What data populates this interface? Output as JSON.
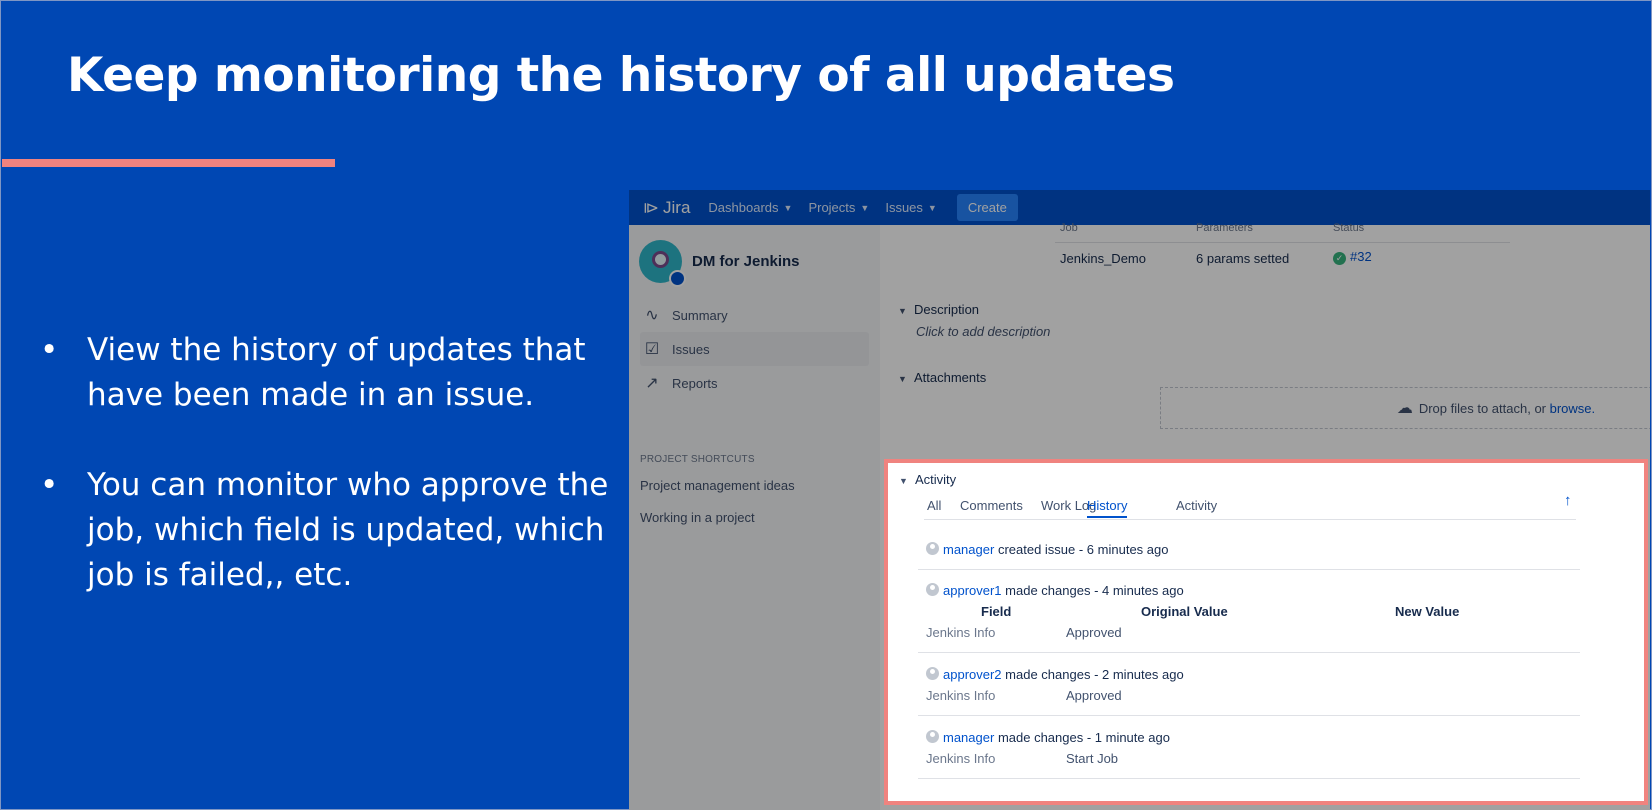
{
  "slide": {
    "title": "Keep monitoring the history of all updates",
    "bullets": [
      "View the history of updates that have been made in an issue.",
      "You can monitor who approve the job, which field is updated, which job is failed,, etc."
    ],
    "bullet_char": "•",
    "colors": {
      "background": "#0047b3",
      "accent": "#f0837f"
    }
  },
  "jira": {
    "logo": "Jira",
    "nav": [
      {
        "label": "Dashboards"
      },
      {
        "label": "Projects"
      },
      {
        "label": "Issues"
      }
    ],
    "create_label": "Create",
    "project_name": "DM for Jenkins",
    "sidebar": {
      "items": [
        {
          "label": "Summary",
          "icon": "pulse-icon"
        },
        {
          "label": "Issues",
          "icon": "issues-icon"
        },
        {
          "label": "Reports",
          "icon": "chart-icon"
        }
      ],
      "shortcuts_title": "PROJECT SHORTCUTS",
      "shortcuts": [
        "Project management ideas",
        "Working in a project"
      ]
    },
    "jobs_table": {
      "headers": [
        "Job",
        "Parameters",
        "Status"
      ],
      "row": {
        "job": "Jenkins_Demo",
        "params": "6 params setted",
        "status": "#32"
      }
    },
    "description": {
      "title": "Description",
      "placeholder": "Click to add description"
    },
    "attachments": {
      "title": "Attachments",
      "more": "•••",
      "drop_text": "Drop files to attach, or",
      "browse": "browse."
    },
    "activity": {
      "title": "Activity",
      "tabs": [
        "All",
        "Comments",
        "Work Log",
        "History",
        "Activity"
      ],
      "active_tab": "History",
      "history_headers": [
        "Field",
        "Original Value",
        "New Value"
      ],
      "entries": [
        {
          "user": "manager",
          "action": "created issue - 6 minutes ago"
        },
        {
          "user": "approver1",
          "action": "made changes - 4 minutes ago",
          "field": "Jenkins Info",
          "original": "Approved"
        },
        {
          "user": "approver2",
          "action": "made changes - 2 minutes ago",
          "field": "Jenkins Info",
          "original": "Approved"
        },
        {
          "user": "manager",
          "action": "made changes - 1 minute ago",
          "field": "Jenkins Info",
          "original": "Start Job"
        }
      ]
    }
  }
}
